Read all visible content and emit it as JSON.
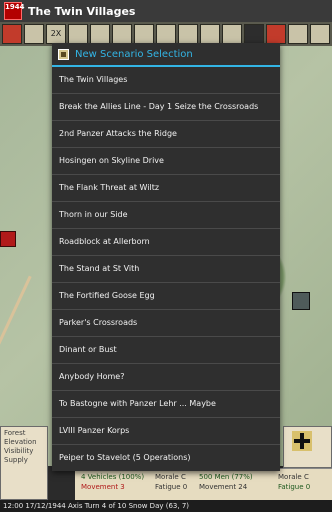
{
  "window": {
    "app_icon_text": "1944",
    "title": "The Twin Villages"
  },
  "toolbar": {
    "buttons": [
      "2X",
      "",
      "",
      "",
      "",
      "",
      "",
      "",
      "",
      "",
      "",
      "",
      "",
      ""
    ]
  },
  "dialog": {
    "title": "New Scenario Selection",
    "scenarios": [
      "The Twin Villages",
      "Break the Allies Line - Day 1 Seize the Crossroads",
      "2nd Panzer Attacks the Ridge",
      "Hosingen on Skyline Drive",
      "The Flank Threat at Wiltz",
      "Thorn in our Side",
      "Roadblock at Allerborn",
      "The Stand at St Vith",
      "The Fortified Goose Egg",
      "Parker's Crossroads",
      "Dinant or Bust",
      "Anybody Home?",
      "To Bastogne with Panzer Lehr ... Maybe",
      "LVIII Panzer Korps",
      "Peiper to Stavelot (5 Operations)"
    ]
  },
  "terrain_panel": {
    "lines": [
      "Forest",
      "Elevation",
      "Visibility",
      "Supply"
    ]
  },
  "unit_panel": {
    "left_vehicles": "4 Vehicles (100%)",
    "left_movement": "Movement 3",
    "left_morale": "Morale C",
    "left_fatigue": "Fatigue 0",
    "right_men": "500 Men (77%)",
    "right_movement": "Movement 24",
    "right_morale": "Morale C",
    "right_fatigue": "Fatigue 0"
  },
  "statusbar": {
    "text": "12:00 17/12/1944 Axis Turn 4 of 10 Snow Day (63, 7)"
  },
  "colors": {
    "accent": "#33b5e5",
    "dialog_bg": "#2f2f2f",
    "app_icon_red": "#b30000"
  }
}
